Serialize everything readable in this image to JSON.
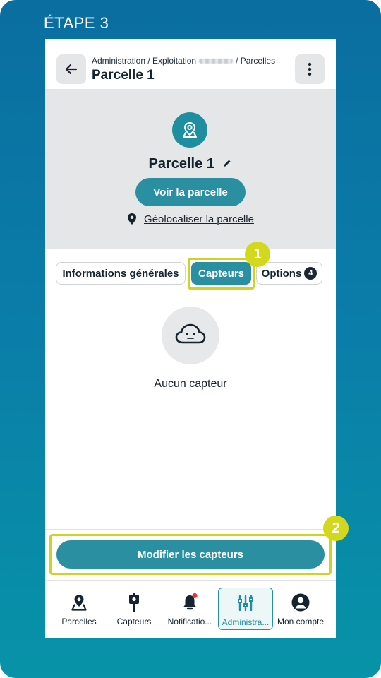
{
  "step_label": "ÉTAPE 3",
  "header": {
    "breadcrumb_part1": "Administration / Exploitation",
    "breadcrumb_part2": "/ Parcelles",
    "title": "Parcelle 1"
  },
  "hero": {
    "name": "Parcelle 1",
    "view_button": "Voir la parcelle",
    "geo_link": "Géolocaliser la parcelle"
  },
  "tabs": [
    {
      "label": "Informations générales"
    },
    {
      "label": "Capteurs",
      "active": true
    },
    {
      "label": "Options",
      "count": "4"
    }
  ],
  "annotations": {
    "badge1": "1",
    "badge2": "2"
  },
  "empty_state": {
    "text": "Aucun capteur"
  },
  "edit_button": "Modifier les capteurs",
  "nav": [
    {
      "label": "Parcelles",
      "icon": "map-pin-icon"
    },
    {
      "label": "Capteurs",
      "icon": "sensor-icon"
    },
    {
      "label": "Notificatio...",
      "icon": "bell-icon"
    },
    {
      "label": "Administra...",
      "icon": "admin-sliders-icon",
      "active": true
    },
    {
      "label": "Mon compte",
      "icon": "account-icon"
    }
  ],
  "colors": {
    "accent": "#2a8fa1",
    "highlight": "#cfd51f",
    "background_gradient_top": "#0a6ea0"
  }
}
